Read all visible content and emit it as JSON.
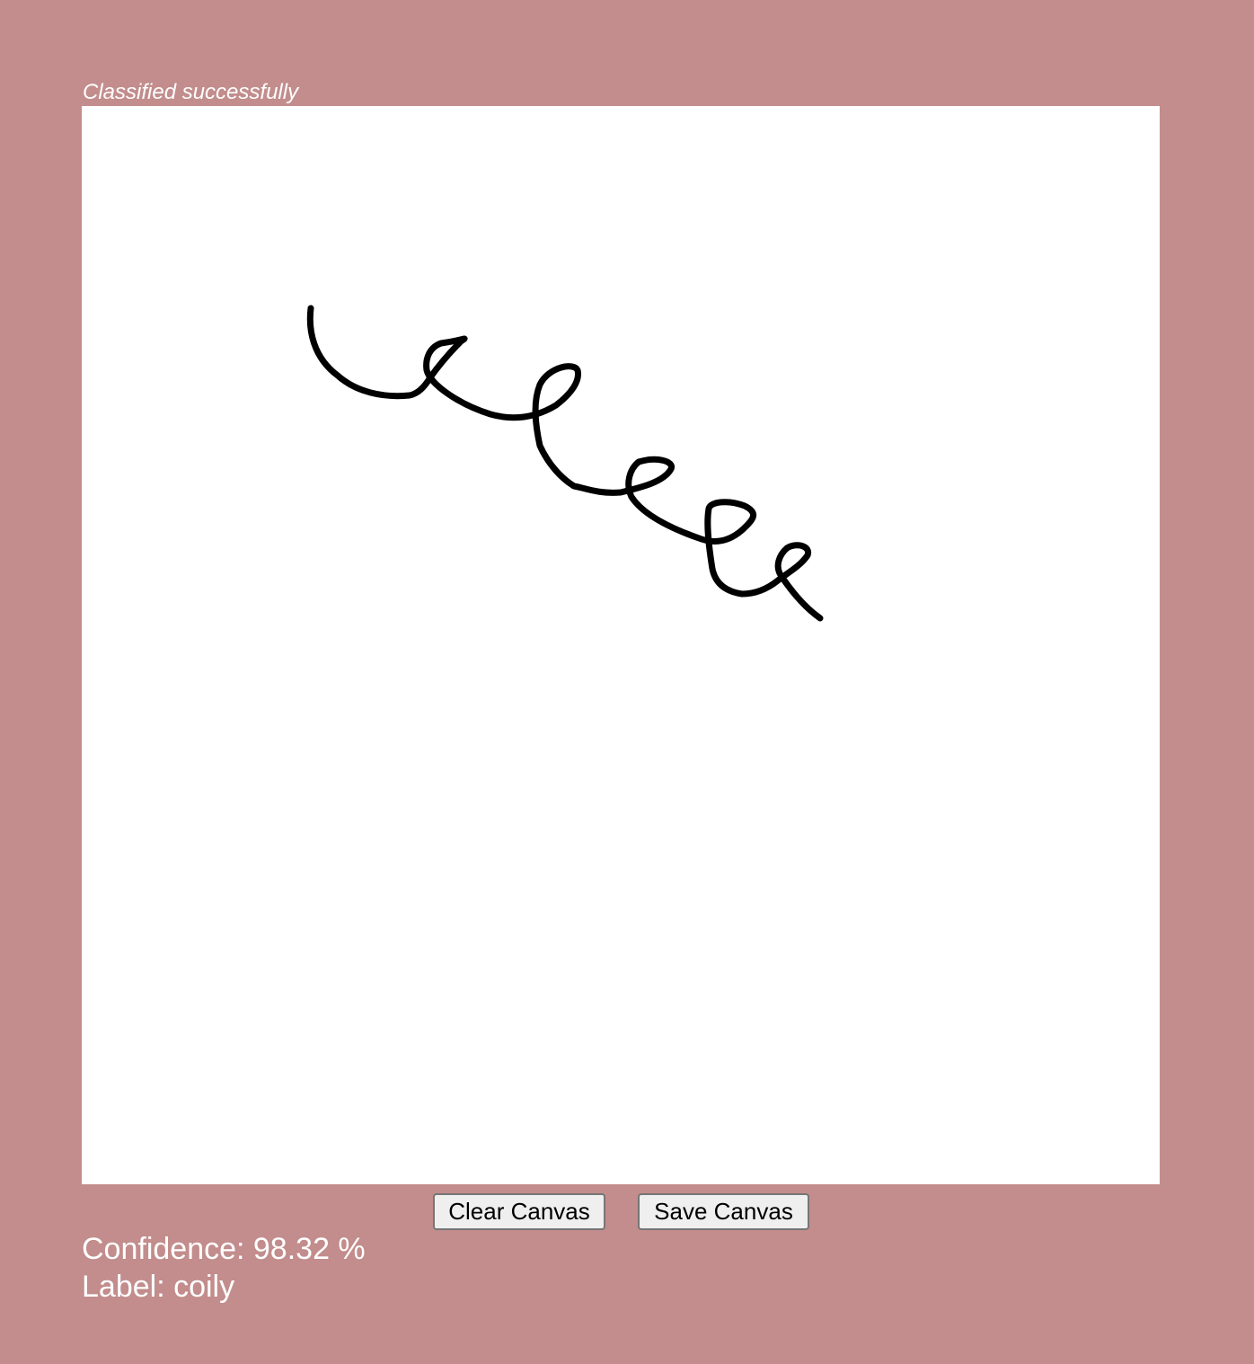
{
  "status": {
    "message": "Classified successfully"
  },
  "canvas": {
    "stroke_color": "#000000",
    "background_color": "#ffffff"
  },
  "controls": {
    "clear_label": "Clear Canvas",
    "save_label": "Save Canvas"
  },
  "result": {
    "confidence_text": "Confidence: 98.32 %",
    "label_text": "Label: coily"
  },
  "colors": {
    "page_background": "#c28d8c",
    "text": "#ffffff"
  }
}
